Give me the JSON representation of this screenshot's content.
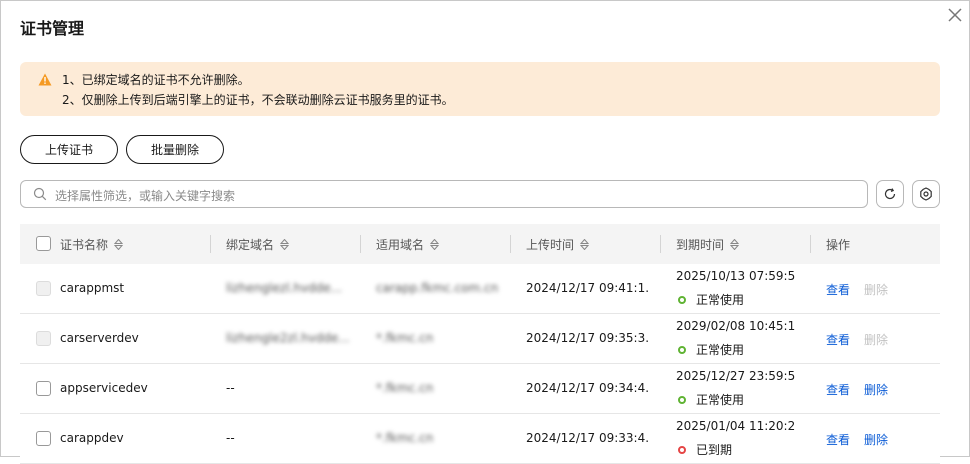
{
  "dialog": {
    "title": "证书管理"
  },
  "notice": {
    "line1": "1、已绑定域名的证书不允许删除。",
    "line2": "2、仅删除上传到后端引擎上的证书，不会联动删除云证书服务里的证书。"
  },
  "toolbar": {
    "upload_label": "上传证书",
    "batch_delete_label": "批量删除"
  },
  "search": {
    "placeholder": "选择属性筛选，或输入关键字搜索"
  },
  "table": {
    "headers": {
      "name": "证书名称",
      "bound": "绑定域名",
      "applicable": "适用域名",
      "upload": "上传时间",
      "expiry": "到期时间",
      "ops": "操作"
    },
    "rows": [
      {
        "name": "carappmst",
        "bound": "lizhenglezl.hvdde...",
        "applicable": "carapp.fkmc.com.cn",
        "upload": "2024/12/17 09:41:1...",
        "expiry": "2025/10/13 07:59:59 (",
        "status": "正常使用",
        "view": "查看",
        "delete": "删除"
      },
      {
        "name": "carserverdev",
        "bound": "lizhengle2zl.hvdde...",
        "applicable": "*.fkmc.cn",
        "upload": "2024/12/17 09:35:3...",
        "expiry": "2029/02/08 10:45:19 (",
        "status": "正常使用",
        "view": "查看",
        "delete": "删除"
      },
      {
        "name": "appservicedev",
        "bound": "--",
        "applicable": "*.fkmc.cn",
        "upload": "2024/12/17 09:34:4...",
        "expiry": "2025/12/27 23:59:59 (",
        "status": "正常使用",
        "view": "查看",
        "delete": "删除"
      },
      {
        "name": "carappdev",
        "bound": "--",
        "applicable": "*.fkmc.cn",
        "upload": "2024/12/17 09:33:4...",
        "expiry": "2025/01/04 11:20:20 (",
        "status": "已到期",
        "view": "查看",
        "delete": "删除"
      }
    ]
  },
  "colors": {
    "link": "#0a5bd6",
    "ok": "#5fb333",
    "expired": "#e54545",
    "notice_bg": "#fdebd7",
    "warn": "#f59a23"
  },
  "icons": [
    "close-icon",
    "warning-icon",
    "search-icon",
    "refresh-icon",
    "gear-icon",
    "sort-icon"
  ]
}
